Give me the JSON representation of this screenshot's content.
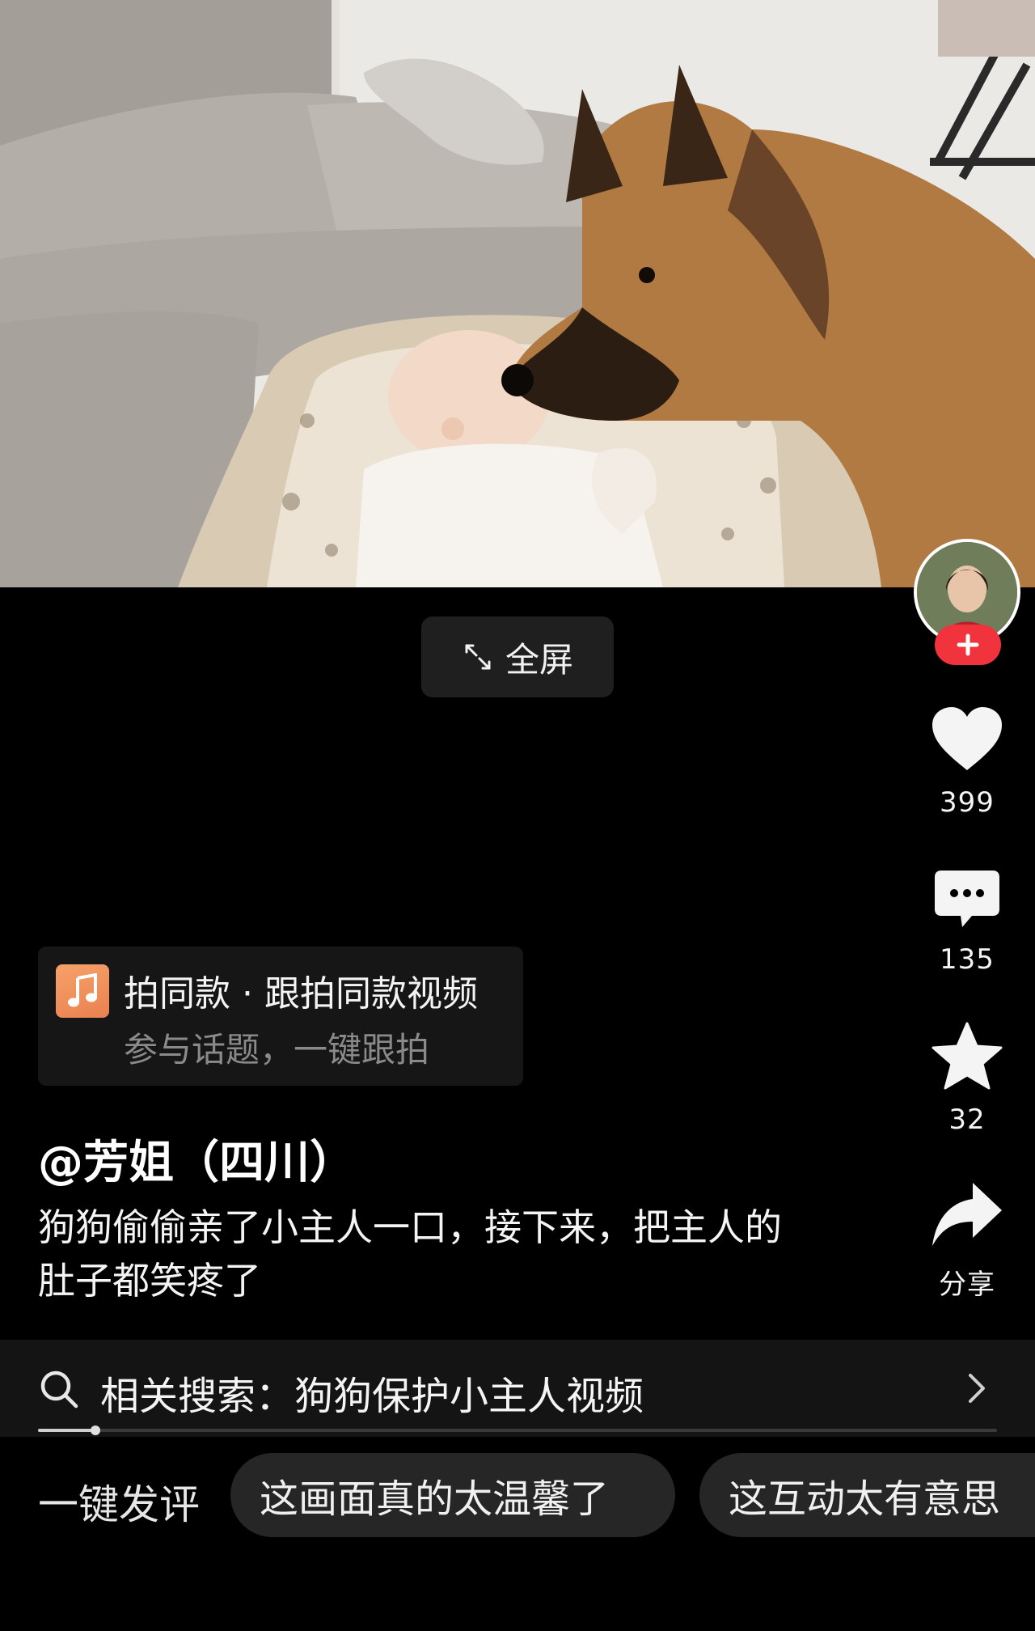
{
  "video": {
    "scene": "video-frame"
  },
  "fullscreen": {
    "label": "全屏",
    "icon": "expand-icon"
  },
  "actions": {
    "avatar_icon": "author-avatar",
    "follow_icon": "plus-icon",
    "like": {
      "icon": "heart-icon",
      "count": "399"
    },
    "comment": {
      "icon": "comment-bubble-icon",
      "count": "135"
    },
    "favorite": {
      "icon": "star-icon",
      "count": "32"
    },
    "share": {
      "icon": "share-arrow-icon",
      "label": "分享"
    }
  },
  "template": {
    "icon": "music-note-icon",
    "title": "拍同款 · 跟拍同款视频",
    "subtitle": "参与话题，一键跟拍"
  },
  "author": "@芳姐（四川）",
  "caption_lines": [
    "狗狗偷偷亲了小主人一口，接下来，把主人的",
    "肚子都笑疼了"
  ],
  "related_search": {
    "icon": "search-icon",
    "label": "相关搜索：狗狗保护小主人视频",
    "chevron": "chevron-right-icon"
  },
  "playback": {
    "progress": 0.06
  },
  "quick_comment": {
    "label": "一键发评",
    "chips": [
      "这画面真的太温馨了",
      "这互动太有意思"
    ]
  },
  "colors": {
    "background": "#000000",
    "follow_red": "#f0333d",
    "music_orange": "#f29a63",
    "chip_bg": "#262626"
  }
}
